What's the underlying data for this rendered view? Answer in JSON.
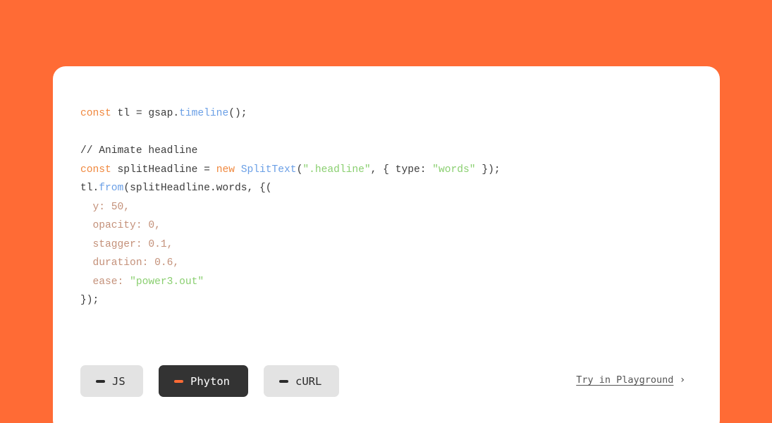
{
  "colors": {
    "background": "#FF6B35",
    "card": "#FFFFFF",
    "keyword": "#F0883E",
    "function": "#6A9FE6",
    "string": "#8ACF70",
    "property": "#C4917A",
    "active_tab": "#333333",
    "inactive_tab": "#E3E3E3"
  },
  "code": {
    "lines": [
      [
        {
          "t": "const",
          "k": "kw"
        },
        {
          "t": " tl = gsap.",
          "k": "plain"
        },
        {
          "t": "timeline",
          "k": "fn"
        },
        {
          "t": "();",
          "k": "plain"
        }
      ],
      [],
      [
        {
          "t": "// Animate headline",
          "k": "comment"
        }
      ],
      [
        {
          "t": "const",
          "k": "kw"
        },
        {
          "t": " splitHeadline = ",
          "k": "plain"
        },
        {
          "t": "new",
          "k": "kw"
        },
        {
          "t": " ",
          "k": "plain"
        },
        {
          "t": "SplitText",
          "k": "fn"
        },
        {
          "t": "(",
          "k": "plain"
        },
        {
          "t": "\".headline\"",
          "k": "str"
        },
        {
          "t": ", { type: ",
          "k": "plain"
        },
        {
          "t": "\"words\"",
          "k": "str"
        },
        {
          "t": " });",
          "k": "plain"
        }
      ],
      [
        {
          "t": "tl.",
          "k": "plain"
        },
        {
          "t": "from",
          "k": "fn"
        },
        {
          "t": "(splitHeadline.words, {(",
          "k": "plain"
        }
      ],
      [
        {
          "t": "  y: 50,",
          "k": "prop"
        }
      ],
      [
        {
          "t": "  opacity: 0,",
          "k": "prop"
        }
      ],
      [
        {
          "t": "  stagger: 0.1,",
          "k": "prop"
        }
      ],
      [
        {
          "t": "  duration: 0.6,",
          "k": "prop"
        }
      ],
      [
        {
          "t": "  ease: ",
          "k": "prop"
        },
        {
          "t": "\"power3.out\"",
          "k": "str"
        }
      ],
      [
        {
          "t": "});",
          "k": "plain"
        }
      ]
    ]
  },
  "tabs": [
    {
      "label": "JS",
      "active": false,
      "icon": "dash-icon"
    },
    {
      "label": "Phyton",
      "active": true,
      "icon": "dash-icon"
    },
    {
      "label": "cURL",
      "active": false,
      "icon": "dash-icon"
    }
  ],
  "playground": {
    "label": "Try in Playground",
    "icon": "chevron-right-icon",
    "glyph": "›"
  }
}
